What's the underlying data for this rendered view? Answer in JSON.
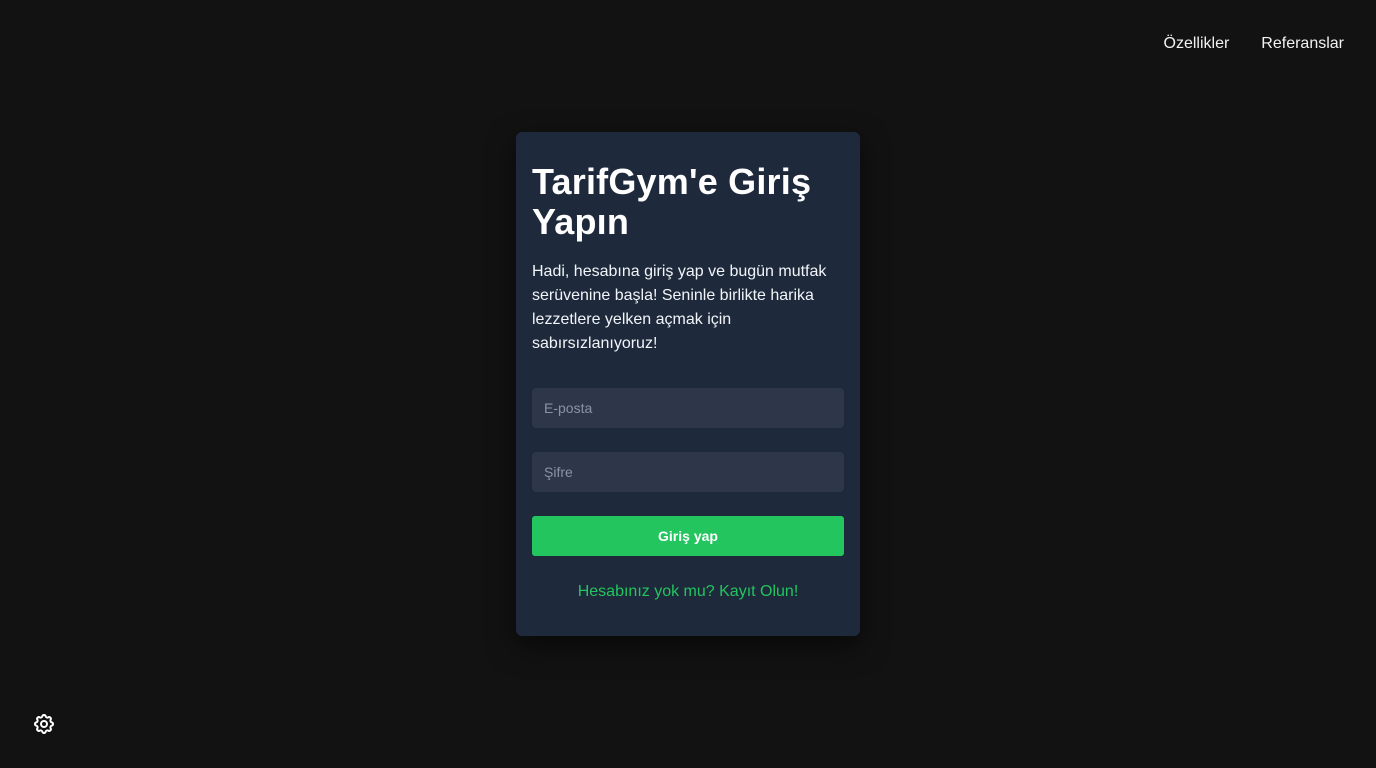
{
  "nav": {
    "features_label": "Özellikler",
    "testimonials_label": "Referanslar"
  },
  "login": {
    "title": "TarifGym'e Giriş Yapın",
    "description": "Hadi, hesabına giriş yap ve bugün mutfak serüvenine başla! Seninle birlikte harika lezzetlere yelken açmak için sabırsızlanıyoruz!",
    "email_placeholder": "E-posta",
    "email_value": "",
    "password_placeholder": "Şifre",
    "password_value": "",
    "submit_label": "Giriş yap",
    "register_link": "Hesabınız yok mu? Kayıt Olun!"
  },
  "icons": {
    "settings": "gear-icon"
  },
  "colors": {
    "background": "#121212",
    "card": "#1e293b",
    "input": "#2e3649",
    "accent": "#22c55e"
  }
}
